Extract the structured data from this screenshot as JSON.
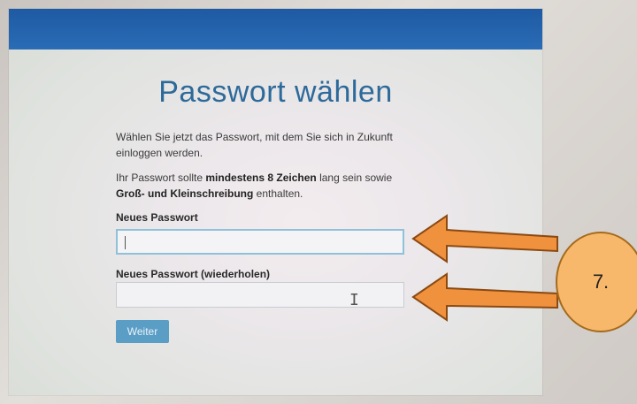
{
  "page": {
    "title": "Passwort wählen",
    "intro": "Wählen Sie jetzt das Passwort, mit dem Sie sich in Zukunft einloggen werden.",
    "requirements": {
      "prefix": "Ihr Passwort sollte ",
      "bold1": "mindestens 8 Zeichen",
      "middle": " lang sein sowie ",
      "bold2": "Groß- und Kleinschreibung",
      "suffix": " enthalten."
    },
    "new_password_label": "Neues Passwort",
    "new_password_value": "",
    "repeat_password_label": "Neues Passwort (wiederholen)",
    "repeat_password_value": "",
    "submit_label": "Weiter"
  },
  "annotation": {
    "step_label": "7.",
    "arrow_color": "#f0913e",
    "circle_color": "#f7b86b"
  },
  "colors": {
    "topbar": "#1e5aa3",
    "title": "#2d6a9a",
    "button": "#5a9ec6"
  }
}
